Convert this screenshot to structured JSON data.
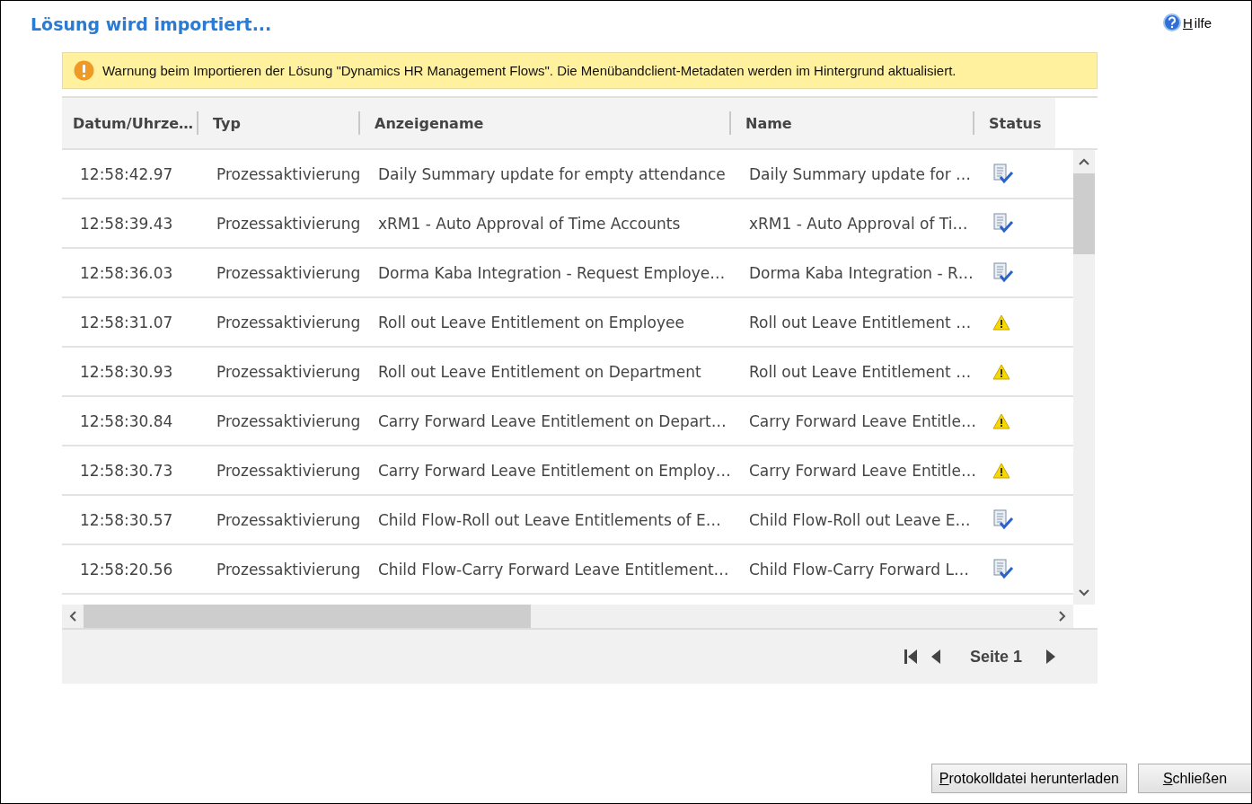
{
  "title": "Lösung wird importiert...",
  "help_link": "Hilfe",
  "warning": "Warnung beim Importieren der Lösung \"Dynamics HR Management Flows\". Die Menübandclient-Metadaten werden im Hintergrund aktualisiert.",
  "table": {
    "columns": [
      "Datum/Uhrze…",
      "Typ",
      "Anzeigename",
      "Name",
      "Status"
    ],
    "rows": [
      {
        "time": "12:58:42.97",
        "type": "Prozessaktivierung",
        "display_name": "Daily Summary update for empty attendance",
        "name": "Daily Summary update for …",
        "kind": "success"
      },
      {
        "time": "12:58:39.43",
        "type": "Prozessaktivierung",
        "display_name": "xRM1 - Auto Approval of Time Accounts",
        "name": "xRM1 - Auto Approval of Ti…",
        "kind": "success"
      },
      {
        "time": "12:58:36.03",
        "type": "Prozessaktivierung",
        "display_name": "Dorma Kaba Integration - Request Employe…",
        "name": "Dorma Kaba Integration - R…",
        "kind": "success"
      },
      {
        "time": "12:58:31.07",
        "type": "Prozessaktivierung",
        "display_name": "Roll out Leave Entitlement on Employee",
        "name": "Roll out Leave Entitlement …",
        "kind": "warning"
      },
      {
        "time": "12:58:30.93",
        "type": "Prozessaktivierung",
        "display_name": "Roll out Leave Entitlement on Department",
        "name": "Roll out Leave Entitlement …",
        "kind": "warning"
      },
      {
        "time": "12:58:30.84",
        "type": "Prozessaktivierung",
        "display_name": "Carry Forward Leave Entitlement on Depart…",
        "name": "Carry Forward Leave Entitle…",
        "kind": "warning"
      },
      {
        "time": "12:58:30.73",
        "type": "Prozessaktivierung",
        "display_name": "Carry Forward Leave Entitlement on Employ…",
        "name": "Carry Forward Leave Entitle…",
        "kind": "warning"
      },
      {
        "time": "12:58:30.57",
        "type": "Prozessaktivierung",
        "display_name": "Child Flow-Roll out Leave Entitlements of E…",
        "name": "Child Flow-Roll out Leave E…",
        "kind": "success"
      },
      {
        "time": "12:58:20.56",
        "type": "Prozessaktivierung",
        "display_name": "Child Flow-Carry Forward Leave Entitlement…",
        "name": "Child Flow-Carry Forward L…",
        "kind": "success"
      }
    ]
  },
  "pager": {
    "label": "Seite 1"
  },
  "buttons": [
    "Protokolldatei herunterladen",
    "Schließen"
  ]
}
